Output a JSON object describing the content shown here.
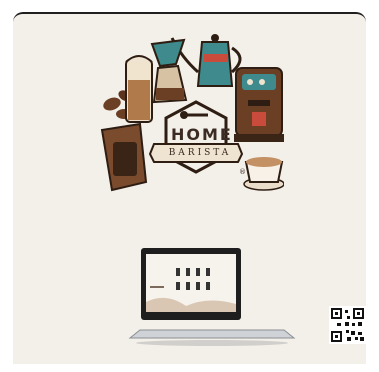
{
  "brand": {
    "line1": "HOME",
    "line2": "BARISTA",
    "registered_mark": "®"
  },
  "icons": {
    "laptop": "laptop-mockup-icon",
    "qr": "qr-code-icon"
  },
  "colors": {
    "background": "#f3efe9",
    "teal": "#3e8a8c",
    "coffee": "#6b3f24",
    "cream": "#f1e4cf",
    "red": "#c94b3b"
  }
}
